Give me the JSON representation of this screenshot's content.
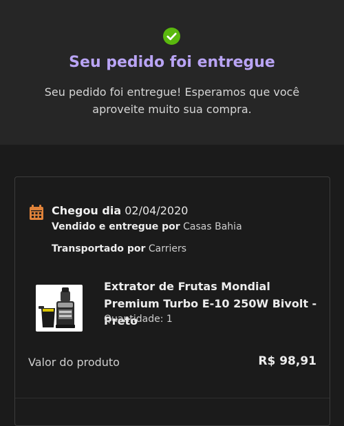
{
  "hero": {
    "title": "Seu pedido foi entregue",
    "message": "Seu pedido foi entregue! Esperamos que você aproveite muito sua compra.",
    "icon": "check-circle-icon",
    "accent": "#b9a4f4",
    "check_color": "#5ab80e"
  },
  "delivery": {
    "icon": "calendar-icon",
    "icon_color": "#e0833a",
    "arrived_label": "Chegou dia",
    "arrived_date": "02/04/2020",
    "sold_label": "Vendido e entregue por",
    "sold_by": "Casas Bahia",
    "carrier_label": "Transportado por",
    "carrier": "Carriers"
  },
  "product": {
    "name": "Extrator de Frutas Mondial Premium Turbo E-10 250W Bivolt - Preto",
    "quantity_label": "Quantidade:",
    "quantity": "1"
  },
  "summary": {
    "value_label": "Valor do produto",
    "value": "R$ 98,91"
  }
}
